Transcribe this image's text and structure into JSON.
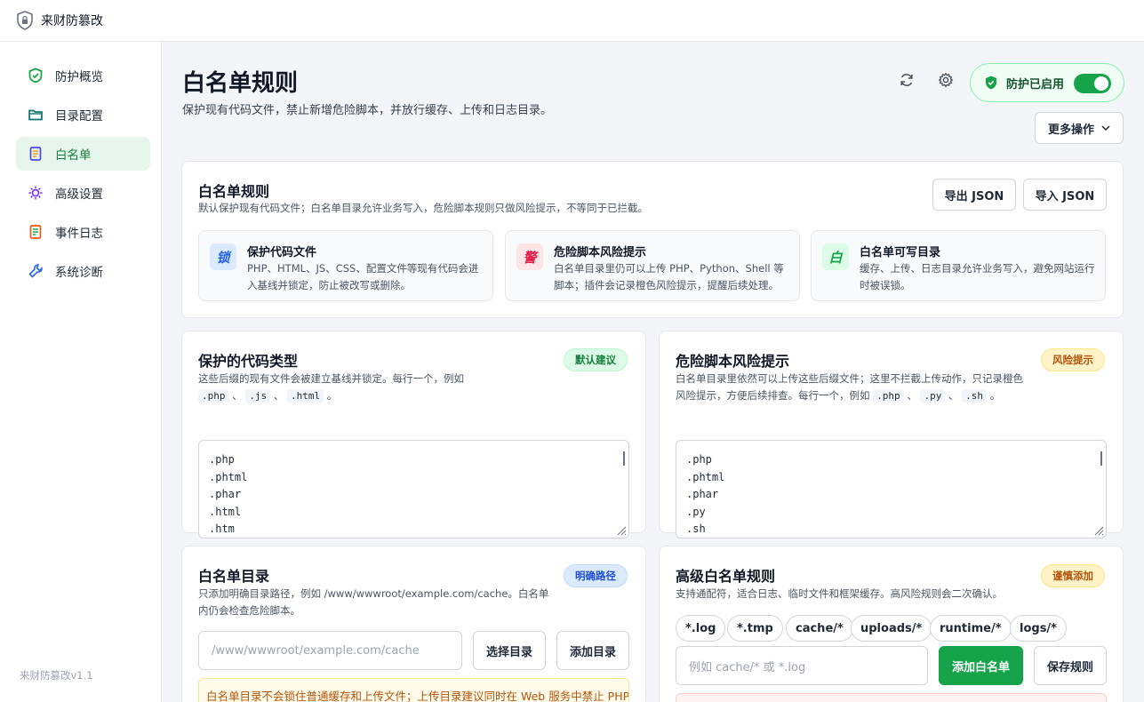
{
  "app": {
    "title": "来财防篡改",
    "version": "来财防篡改v1.1"
  },
  "sidebar": {
    "items": [
      {
        "label": "防护概览",
        "icon": "shield-check-icon"
      },
      {
        "label": "目录配置",
        "icon": "folder-icon"
      },
      {
        "label": "白名单",
        "icon": "document-list-icon"
      },
      {
        "label": "高级设置",
        "icon": "gear-sun-icon"
      },
      {
        "label": "事件日志",
        "icon": "log-icon"
      },
      {
        "label": "系统诊断",
        "icon": "wrench-icon"
      }
    ],
    "active": "白名单"
  },
  "header": {
    "title": "白名单规则",
    "subtitle": "保护现有代码文件，禁止新增危险脚本，并放行缓存、上传和日志目录。",
    "protection_label": "防护已启用",
    "protection_on": true,
    "more_label": "更多操作"
  },
  "rules_card": {
    "title": "白名单规则",
    "desc": "默认保护现有代码文件；白名单目录允许业务写入，危险脚本规则只做风险提示，不等同于已拦截。",
    "export_label": "导出 JSON",
    "import_label": "导入 JSON",
    "features": [
      {
        "badge": "锁",
        "title": "保护代码文件",
        "desc": "PHP、HTML、JS、CSS、配置文件等现有代码会进入基线并锁定，防止被改写或删除。"
      },
      {
        "badge": "警",
        "title": "危险脚本风险提示",
        "desc": "白名单目录里仍可以上传 PHP、Python、Shell 等脚本；插件会记录橙色风险提示，提醒后续处理。"
      },
      {
        "badge": "白",
        "title": "白名单可写目录",
        "desc": "缓存、上传、日志目录允许业务写入，避免网站运行时被误锁。"
      }
    ]
  },
  "protected_types": {
    "title": "保护的代码类型",
    "tag": "默认建议",
    "desc_prefix": "这些后缀的现有文件会被建立基线并锁定。每行一个，例如",
    "examples": [
      ".php",
      ".js",
      ".html"
    ],
    "sep": "、",
    "end": "。",
    "lines": [
      ".php",
      ".phtml",
      ".phar",
      ".html",
      ".htm"
    ]
  },
  "danger_scripts": {
    "title": "危险脚本风险提示",
    "tag": "风险提示",
    "desc_prefix": "白名单目录里依然可以上传这些后缀文件；这里不拦截上传动作，只记录橙色风险提示，方便后续排查。每行一个，例如",
    "examples": [
      ".php",
      ".py",
      ".sh"
    ],
    "sep": "、",
    "end": "。",
    "lines": [
      ".php",
      ".phtml",
      ".phar",
      ".py",
      ".sh"
    ]
  },
  "whitelist_dirs": {
    "title": "白名单目录",
    "tag": "明确路径",
    "desc": "只添加明确目录路径，例如 /www/wwwroot/example.com/cache。白名单内仍会检查危险脚本。",
    "placeholder": "/www/wwwroot/example.com/cache",
    "choose_label": "选择目录",
    "add_label": "添加目录",
    "warning": "白名单目录不会锁住普通缓存和上传文件；上传目录建议同时在 Web 服务中禁止 PHP。"
  },
  "advanced_rules": {
    "title": "高级白名单规则",
    "tag": "谨慎添加",
    "desc": "支持通配符，适合日志、临时文件和框架缓存。高风险规则会二次确认。",
    "chips": [
      "*.log",
      "*.tmp",
      "cache/*",
      "uploads/*",
      "runtime/*",
      "logs/*"
    ],
    "placeholder": "例如 cache/* 或 *.log",
    "add_label": "添加白名单",
    "save_label": "保存规则"
  },
  "colors": {
    "accent": "#16a34a",
    "active_bg": "#e7f6ec",
    "warn": "#b45309",
    "lock_badge": "#2563eb",
    "alert_badge": "#e11d48"
  }
}
